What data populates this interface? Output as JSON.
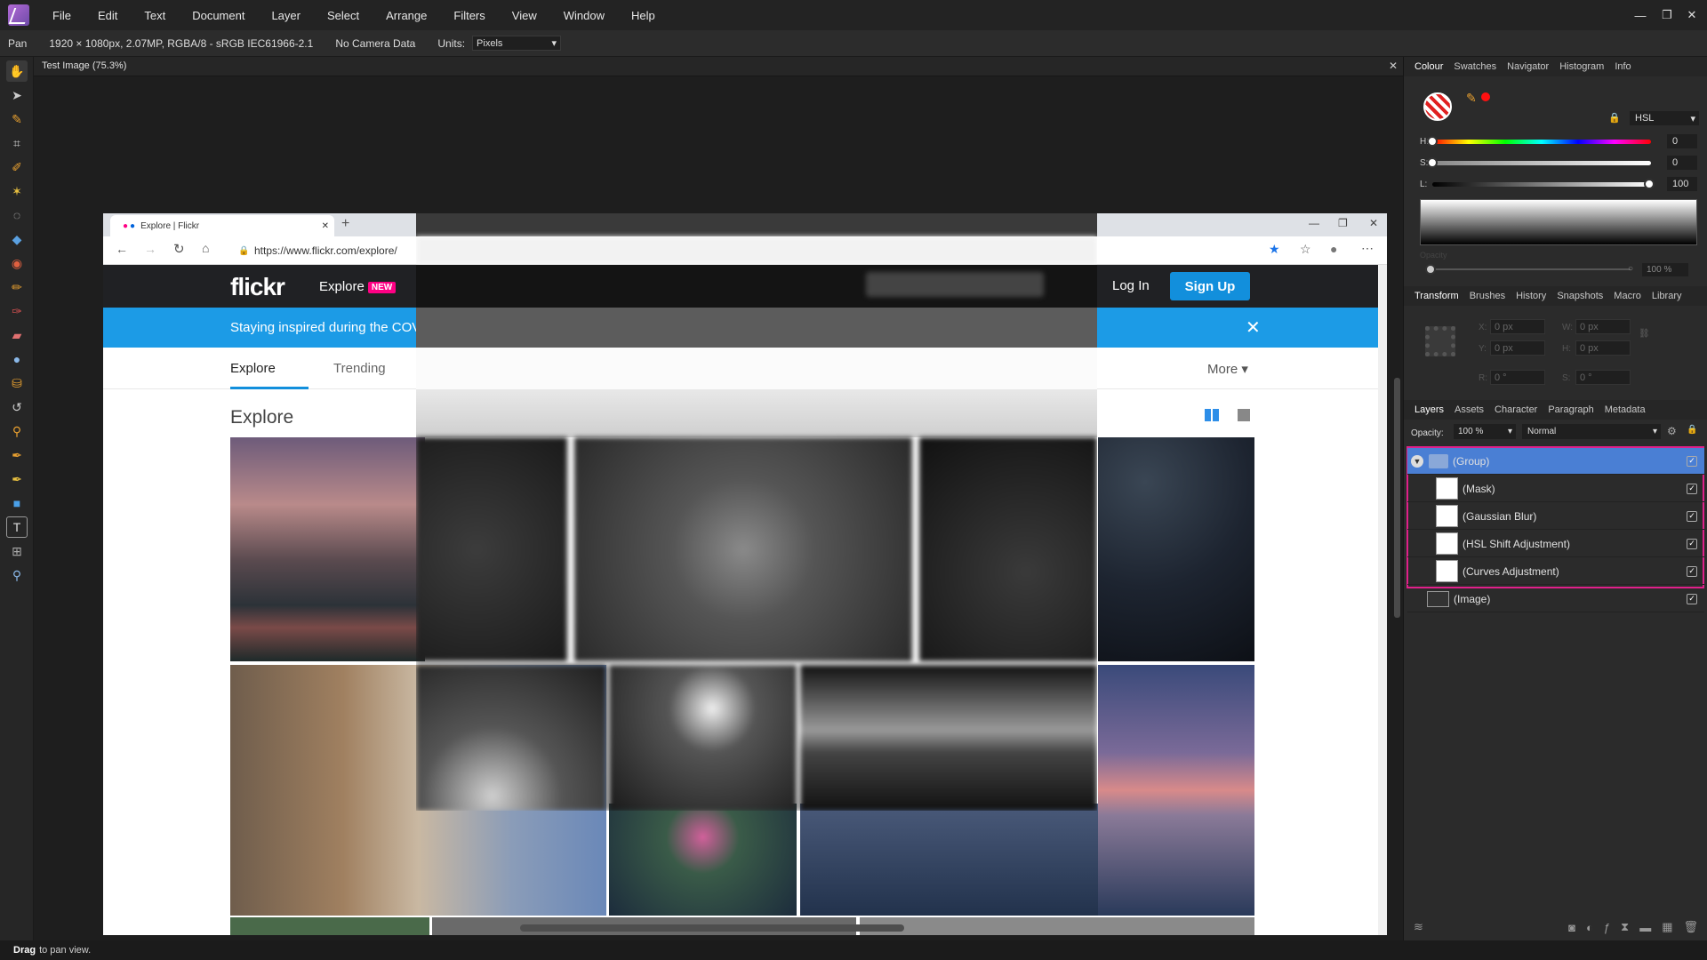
{
  "menu": {
    "app_logo": "affinity-photo-logo",
    "items": [
      "File",
      "Edit",
      "Text",
      "Document",
      "Layer",
      "Select",
      "Arrange",
      "Filters",
      "View",
      "Window",
      "Help"
    ]
  },
  "context_bar": {
    "tool": "Pan",
    "doc_info": "1920 × 1080px, 2.07MP, RGBA/8 - sRGB IEC61966-2.1",
    "camera": "No Camera Data",
    "units_label": "Units:",
    "units_value": "Pixels"
  },
  "document_tab": {
    "title": "Test Image (75.3%)"
  },
  "status": {
    "bold": "Drag",
    "text": "to pan view."
  },
  "browser": {
    "tab_title": "Explore | Flickr",
    "new_tab": "+",
    "url": "https://www.flickr.com/explore/",
    "flickr": {
      "logo": "flickr",
      "explore": "Explore",
      "new_badge": "NEW",
      "login": "Log In",
      "signup": "Sign Up",
      "covid": "Staying inspired during the COV",
      "close": "✕",
      "subnav": [
        "Explore",
        "Trending"
      ],
      "more": "More ▾",
      "heading": "Explore"
    }
  },
  "panels": {
    "colour_tabs": [
      "Colour",
      "Swatches",
      "Navigator",
      "Histogram",
      "Info"
    ],
    "colour_mode": "HSL",
    "h_label": "H:",
    "h_value": "0",
    "s_label": "S:",
    "s_value": "0",
    "l_label": "L:",
    "l_value": "100",
    "opacity_label": "Opacity",
    "opacity_value": "100 %",
    "transform_tabs": [
      "Transform",
      "Brushes",
      "History",
      "Snapshots",
      "Macro",
      "Library"
    ],
    "transform_fields": {
      "x_label": "X:",
      "x": "0 px",
      "y_label": "Y:",
      "y": "0 px",
      "w_label": "W:",
      "w": "0 px",
      "h_label": "H:",
      "h": "0 px",
      "r_label": "R:",
      "r": "0 °",
      "s_label": "S:",
      "s": "0 °"
    },
    "layers_tabs": [
      "Layers",
      "Assets",
      "Character",
      "Paragraph",
      "Metadata"
    ],
    "layers_opacity_label": "Opacity:",
    "layers_opacity": "100 %",
    "blend_mode": "Normal",
    "layers": [
      {
        "name": "(Group)"
      },
      {
        "name": "(Mask)"
      },
      {
        "name": "(Gaussian Blur)"
      },
      {
        "name": "(HSL Shift Adjustment)"
      },
      {
        "name": "(Curves Adjustment)"
      },
      {
        "name": "(Image)"
      }
    ]
  },
  "colors": {
    "accent": "#4a7fd4",
    "selection_border": "#e0208a",
    "flickr_blue": "#128fdc",
    "flickr_pink": "#ff0084"
  }
}
